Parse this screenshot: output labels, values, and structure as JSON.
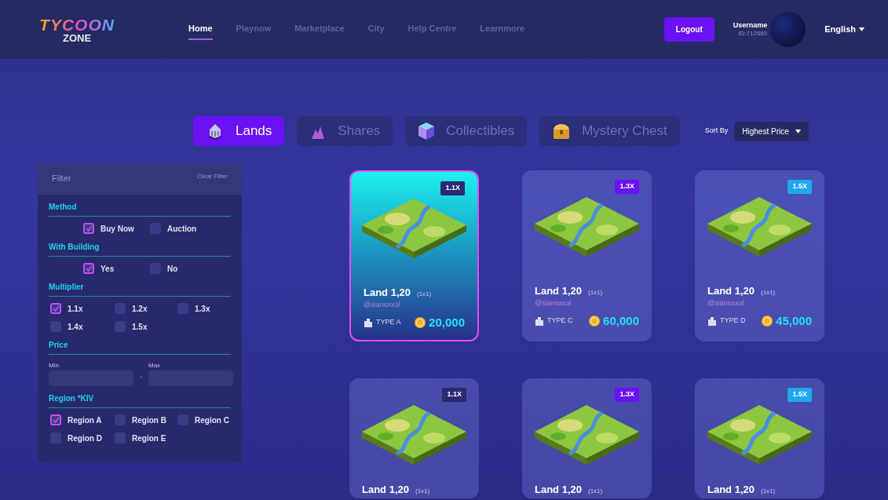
{
  "logo": {
    "top": "TYCOON",
    "bottom": "ZONE"
  },
  "nav": [
    {
      "label": "Home",
      "selected": true
    },
    {
      "label": "Playnow",
      "selected": false
    },
    {
      "label": "Marketplace",
      "selected": false
    },
    {
      "label": "City",
      "selected": false
    },
    {
      "label": "Help Centre",
      "selected": false
    },
    {
      "label": "Learnmore",
      "selected": false
    }
  ],
  "logout": "Logout",
  "user": {
    "name": "Username",
    "id": "ID:712685"
  },
  "language": "English",
  "tabs": [
    {
      "label": "Lands",
      "kind": "land",
      "selected": true
    },
    {
      "label": "Shares",
      "kind": "shares",
      "selected": false
    },
    {
      "label": "Collectibles",
      "kind": "cube",
      "selected": false
    },
    {
      "label": "Mystery Chest",
      "kind": "chest",
      "selected": false
    }
  ],
  "sort": {
    "label": "Sort By",
    "value": "Highest Price"
  },
  "filter": {
    "title": "Filter",
    "clear": "Clear Filter",
    "sections": [
      {
        "kind": "checks",
        "title": "Method",
        "options": [
          {
            "label": "Buy Now",
            "checked": true
          },
          {
            "label": "Auction",
            "checked": false
          }
        ]
      },
      {
        "kind": "checks",
        "title": "With Building",
        "options": [
          {
            "label": "Yes",
            "checked": true
          },
          {
            "label": "No",
            "checked": false
          }
        ]
      },
      {
        "kind": "grid",
        "title": "Multiplier",
        "options": [
          {
            "label": "1.1x",
            "checked": true
          },
          {
            "label": "1.2x",
            "checked": false
          },
          {
            "label": "1.3x",
            "checked": false
          },
          {
            "label": "1.4x",
            "checked": false
          },
          {
            "label": "1.5x",
            "checked": false
          }
        ]
      },
      {
        "kind": "range",
        "title": "Price",
        "min_label": "Min",
        "max_label": "Max",
        "separator": "-"
      },
      {
        "kind": "grid",
        "title": "Region *KIV",
        "options": [
          {
            "label": "Region A",
            "checked": true
          },
          {
            "label": "Region B",
            "checked": false
          },
          {
            "label": "Region C",
            "checked": false
          },
          {
            "label": "Region D",
            "checked": false
          },
          {
            "label": "Region E",
            "checked": false
          }
        ]
      }
    ]
  },
  "cards": [
    {
      "badge": "1.1X",
      "color": "#2b2a72",
      "selected": true,
      "title": "Land 1,20",
      "size": "(1x1)",
      "owner": "@siansxxol",
      "type": "TYPE A",
      "price": "20,000"
    },
    {
      "badge": "1.3X",
      "color": "#6a12f4",
      "selected": false,
      "title": "Land 1,20",
      "size": "(1x1)",
      "owner": "@siansxxol",
      "type": "TYPE C",
      "price": "60,000"
    },
    {
      "badge": "1.5X",
      "color": "#20a8ee",
      "selected": false,
      "title": "Land 1,20",
      "size": "(1x1)",
      "owner": "@siansxxol",
      "type": "TYPE D",
      "price": "45,000"
    },
    {
      "badge": "1.1X",
      "color": "#2b2a72",
      "selected": false,
      "title": "Land 1,20",
      "size": "(1x1)"
    },
    {
      "badge": "1.3X",
      "color": "#6a12f4",
      "selected": false,
      "title": "Land 1,20",
      "size": "(1x1)"
    },
    {
      "badge": "1.5X",
      "color": "#20a8ee",
      "selected": false,
      "title": "Land 1,20",
      "size": "(1x1)"
    }
  ]
}
